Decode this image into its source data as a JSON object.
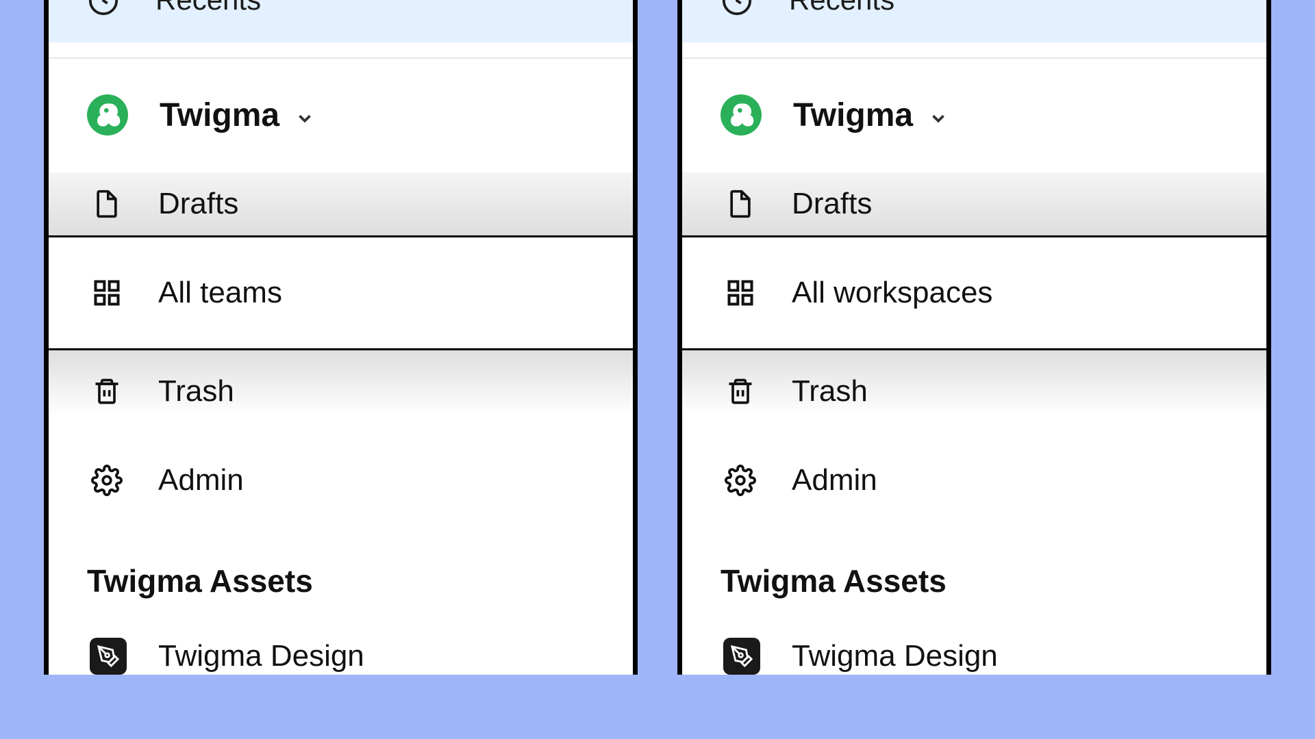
{
  "colors": {
    "accent_green": "#2bb05a",
    "highlight_blue": "#e3f0ff",
    "bg_page": "#9eb6f7"
  },
  "left": {
    "recents_label": "Recents",
    "org_name": "Twigma",
    "nav": {
      "drafts": "Drafts",
      "all": "All teams",
      "trash": "Trash",
      "admin": "Admin"
    },
    "section_title": "Twigma Assets",
    "asset_0": "Twigma Design"
  },
  "right": {
    "recents_label": "Recents",
    "org_name": "Twigma",
    "nav": {
      "drafts": "Drafts",
      "all": "All workspaces",
      "trash": "Trash",
      "admin": "Admin"
    },
    "section_title": "Twigma Assets",
    "asset_0": "Twigma Design"
  }
}
